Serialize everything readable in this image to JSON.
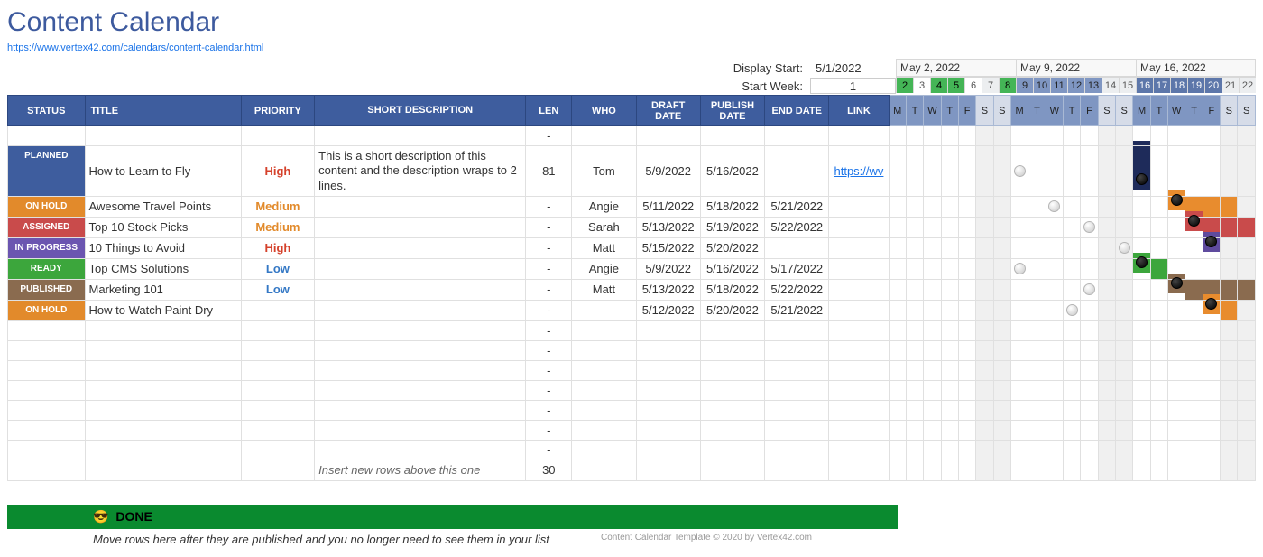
{
  "header": {
    "title": "Content Calendar",
    "source_url": "https://www.vertex42.com/calendars/content-calendar.html"
  },
  "controls": {
    "display_start_label": "Display Start:",
    "display_start_value": "5/1/2022",
    "start_week_label": "Start Week:",
    "start_week_value": "1"
  },
  "calendar": {
    "weeks": [
      "May 2, 2022",
      "May 9, 2022",
      "May 16, 2022"
    ],
    "day_numbers": [
      "2",
      "3",
      "4",
      "5",
      "6",
      "7",
      "8",
      "9",
      "10",
      "11",
      "12",
      "13",
      "14",
      "15",
      "16",
      "17",
      "18",
      "19",
      "20",
      "21",
      "22"
    ],
    "day_letters": [
      "M",
      "T",
      "W",
      "T",
      "F",
      "S",
      "S",
      "M",
      "T",
      "W",
      "T",
      "F",
      "S",
      "S",
      "M",
      "T",
      "W",
      "T",
      "F",
      "S",
      "S"
    ],
    "day_shade": [
      "green",
      "",
      "green",
      "green",
      "",
      "",
      "green",
      "blue",
      "blue",
      "blue",
      "blue",
      "blue",
      "",
      "",
      "darkblue",
      "darkblue",
      "darkblue",
      "darkblue",
      "darkblue",
      "",
      ""
    ]
  },
  "columns": {
    "status": "STATUS",
    "title": "TITLE",
    "priority": "PRIORITY",
    "desc": "SHORT DESCRIPTION",
    "len": "LEN",
    "who": "WHO",
    "draft": "DRAFT DATE",
    "publish": "PUBLISH DATE",
    "end": "END DATE",
    "link": "LINK"
  },
  "status_colors": {
    "PLANNED": "#3e5d9e",
    "ON HOLD": "#e28a2b",
    "ASSIGNED": "#c94b4b",
    "IN PROGRESS": "#6b55b0",
    "READY": "#3ca63c",
    "PUBLISHED": "#8a6b4f"
  },
  "rows": [
    {
      "status": "",
      "title": "",
      "priority": "",
      "desc": "",
      "len": "-",
      "who": "",
      "draft": "",
      "publish": "",
      "end": "",
      "link": "",
      "dark_at": -1,
      "light_at": -1,
      "bar_start": -1,
      "bar_end": -1,
      "bar_class": "",
      "publish_marker": -1
    },
    {
      "status": "PLANNED",
      "title": "How to Learn to Fly",
      "priority": "High",
      "desc": "This is a short description of this content and the description wraps to 2 lines.",
      "len": "81",
      "who": "Tom",
      "draft": "5/9/2022",
      "publish": "5/16/2022",
      "end": "",
      "link": "https://wv",
      "light_at": 7,
      "publish_marker": 14,
      "dark_at": 14,
      "bar_start": -1,
      "bar_end": -1,
      "bar_class": "bar-dark"
    },
    {
      "status": "ON HOLD",
      "title": "Awesome Travel Points",
      "priority": "Medium",
      "desc": "",
      "len": "-",
      "who": "Angie",
      "draft": "5/11/2022",
      "publish": "5/18/2022",
      "end": "5/21/2022",
      "link": "",
      "light_at": 9,
      "publish_marker": 16,
      "bar_start": 16,
      "bar_end": 19,
      "bar_class": "bar-orange"
    },
    {
      "status": "ASSIGNED",
      "title": "Top 10 Stock Picks",
      "priority": "Medium",
      "desc": "",
      "len": "-",
      "who": "Sarah",
      "draft": "5/13/2022",
      "publish": "5/19/2022",
      "end": "5/22/2022",
      "link": "",
      "light_at": 11,
      "publish_marker": 17,
      "bar_start": 17,
      "bar_end": 20,
      "bar_class": "bar-red"
    },
    {
      "status": "IN PROGRESS",
      "title": "10 Things to Avoid",
      "priority": "High",
      "desc": "",
      "len": "-",
      "who": "Matt",
      "draft": "5/15/2022",
      "publish": "5/20/2022",
      "end": "",
      "link": "",
      "light_at": 13,
      "publish_marker": 18,
      "bar_start": 18,
      "bar_end": 18,
      "bar_class": "bar-purple"
    },
    {
      "status": "READY",
      "title": "Top CMS Solutions",
      "priority": "Low",
      "desc": "",
      "len": "-",
      "who": "Angie",
      "draft": "5/9/2022",
      "publish": "5/16/2022",
      "end": "5/17/2022",
      "link": "",
      "light_at": 7,
      "publish_marker": 14,
      "bar_start": 14,
      "bar_end": 15,
      "bar_class": "bar-green"
    },
    {
      "status": "PUBLISHED",
      "title": "Marketing 101",
      "priority": "Low",
      "desc": "",
      "len": "-",
      "who": "Matt",
      "draft": "5/13/2022",
      "publish": "5/18/2022",
      "end": "5/22/2022",
      "link": "",
      "light_at": 11,
      "publish_marker": 16,
      "bar_start": 16,
      "bar_end": 20,
      "bar_class": "bar-brown"
    },
    {
      "status": "ON HOLD",
      "title": "How to Watch Paint Dry",
      "priority": "",
      "desc": "",
      "len": "-",
      "who": "",
      "draft": "5/12/2022",
      "publish": "5/20/2022",
      "end": "5/21/2022",
      "link": "",
      "light_at": 10,
      "publish_marker": 18,
      "bar_start": 18,
      "bar_end": 19,
      "bar_class": "bar-orange"
    },
    {
      "status": "",
      "title": "",
      "priority": "",
      "desc": "",
      "len": "-",
      "who": "",
      "draft": "",
      "publish": "",
      "end": "",
      "link": "",
      "light_at": -1,
      "publish_marker": -1,
      "bar_start": -1,
      "bar_end": -1,
      "bar_class": ""
    },
    {
      "status": "",
      "title": "",
      "priority": "",
      "desc": "",
      "len": "-",
      "who": "",
      "draft": "",
      "publish": "",
      "end": "",
      "link": "",
      "light_at": -1,
      "publish_marker": -1,
      "bar_start": -1,
      "bar_end": -1,
      "bar_class": ""
    },
    {
      "status": "",
      "title": "",
      "priority": "",
      "desc": "",
      "len": "-",
      "who": "",
      "draft": "",
      "publish": "",
      "end": "",
      "link": "",
      "light_at": -1,
      "publish_marker": -1,
      "bar_start": -1,
      "bar_end": -1,
      "bar_class": ""
    },
    {
      "status": "",
      "title": "",
      "priority": "",
      "desc": "",
      "len": "-",
      "who": "",
      "draft": "",
      "publish": "",
      "end": "",
      "link": "",
      "light_at": -1,
      "publish_marker": -1,
      "bar_start": -1,
      "bar_end": -1,
      "bar_class": ""
    },
    {
      "status": "",
      "title": "",
      "priority": "",
      "desc": "",
      "len": "-",
      "who": "",
      "draft": "",
      "publish": "",
      "end": "",
      "link": "",
      "light_at": -1,
      "publish_marker": -1,
      "bar_start": -1,
      "bar_end": -1,
      "bar_class": ""
    },
    {
      "status": "",
      "title": "",
      "priority": "",
      "desc": "",
      "len": "-",
      "who": "",
      "draft": "",
      "publish": "",
      "end": "",
      "link": "",
      "light_at": -1,
      "publish_marker": -1,
      "bar_start": -1,
      "bar_end": -1,
      "bar_class": ""
    },
    {
      "status": "",
      "title": "",
      "priority": "",
      "desc": "",
      "len": "-",
      "who": "",
      "draft": "",
      "publish": "",
      "end": "",
      "link": "",
      "light_at": -1,
      "publish_marker": -1,
      "bar_start": -1,
      "bar_end": -1,
      "bar_class": ""
    },
    {
      "status": "",
      "title": "",
      "priority": "",
      "desc": "Insert new rows above this one",
      "desc_italic": true,
      "len": "30",
      "who": "",
      "draft": "",
      "publish": "",
      "end": "",
      "link": "",
      "light_at": -1,
      "publish_marker": -1,
      "bar_start": -1,
      "bar_end": -1,
      "bar_class": ""
    }
  ],
  "weekend_cols": [
    5,
    6,
    12,
    13,
    19,
    20
  ],
  "done": {
    "label": "DONE",
    "note": "Move rows here after they are published and you no longer need to see them in your list",
    "copyright": "Content Calendar Template © 2020 by Vertex42.com"
  }
}
